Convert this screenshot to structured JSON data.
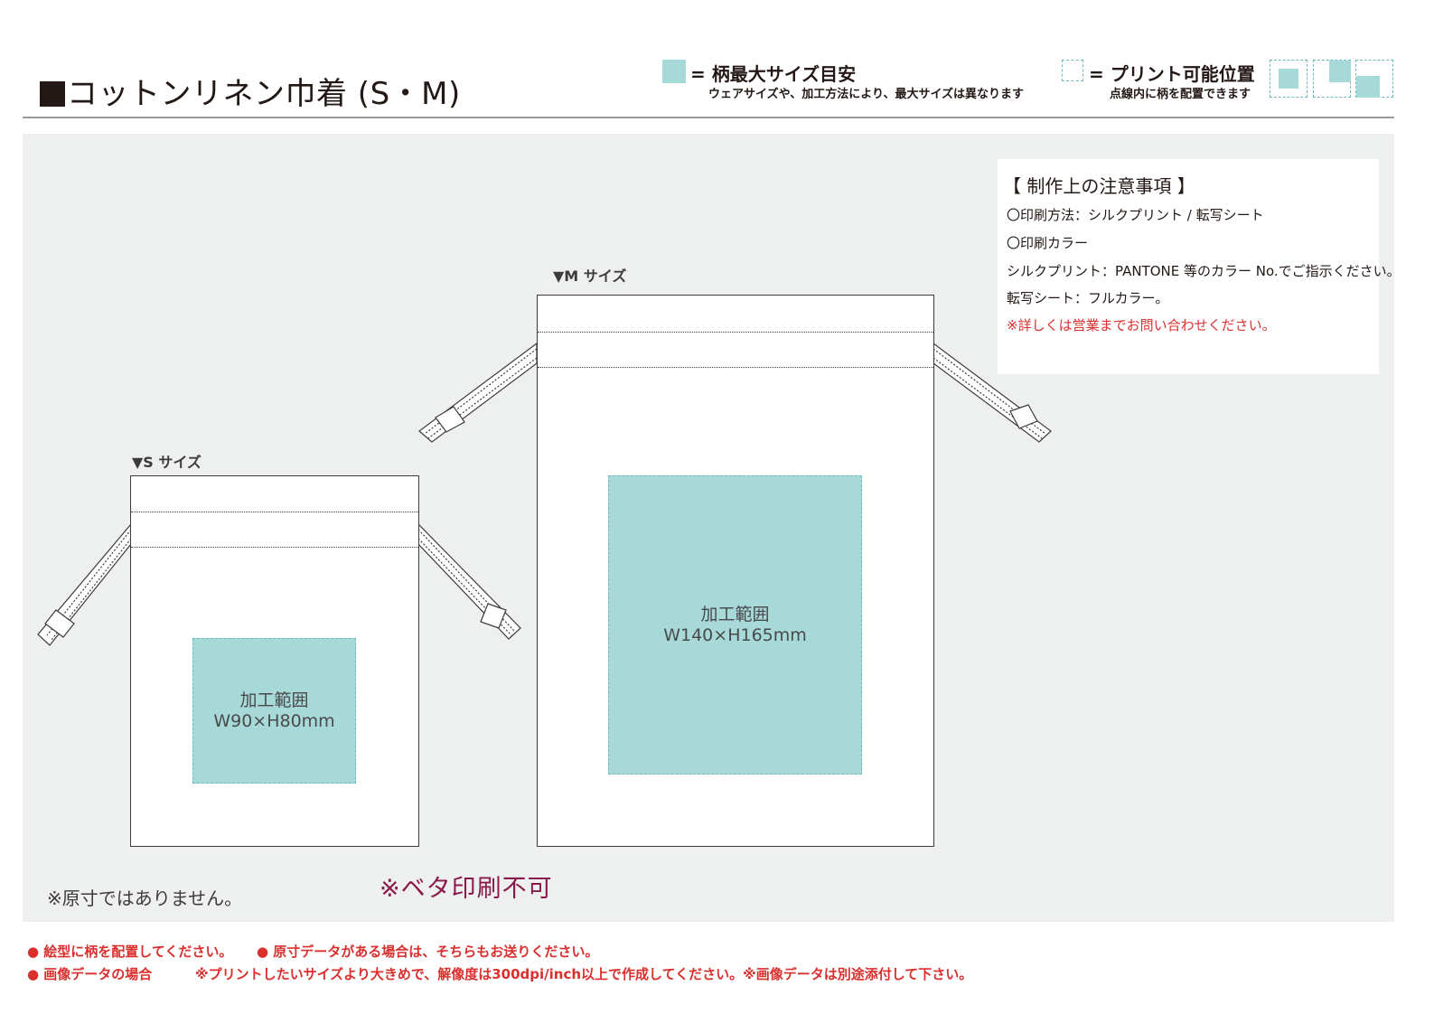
{
  "header": {
    "title": "コットンリネン巾着 (S・M)",
    "legend_max": {
      "label": "= 柄最大サイズ目安",
      "sub": "ウェアサイズや、加工方法により、最大サイズは異なります"
    },
    "legend_position": {
      "label": "= プリント可能位置",
      "sub": "点線内に柄を配置できます"
    }
  },
  "bags": {
    "small": {
      "size_label": "▼S サイズ",
      "area_title": "加工範囲",
      "area_size": "W90×H80mm"
    },
    "medium": {
      "size_label": "▼M サイズ",
      "area_title": "加工範囲",
      "area_size": "W140×H165mm"
    }
  },
  "notes": {
    "heading": "【 制作上の注意事項 】",
    "lines": [
      "〇印刷方法：シルクプリント / 転写シート",
      "〇印刷カラー",
      "シルクプリント：PANTONE 等のカラー No.でご指示ください。",
      "転写シート：フルカラー。"
    ],
    "warning": "※詳しくは営業までお問い合わせください。"
  },
  "remarks": {
    "not_to_scale": "※原寸ではありません。",
    "no_solid_print": "※ベタ印刷不可"
  },
  "footer": {
    "line1a": "● 絵型に柄を配置してください。",
    "line1b": "● 原寸データがある場合は、そちらもお送りください。",
    "line2a": "● 画像データの場合",
    "line2b": "※プリントしたいサイズより大きめで、解像度は300dpi/inch以上で作成してください。※画像データは別途添付して下さい。"
  },
  "colors": {
    "print_area": "#a7d9d9",
    "print_area_border": "#6bbcbc",
    "panel_bg": "#eef0ef",
    "warning_red": "#d9302e",
    "beta_text": "#8b1a4c"
  }
}
